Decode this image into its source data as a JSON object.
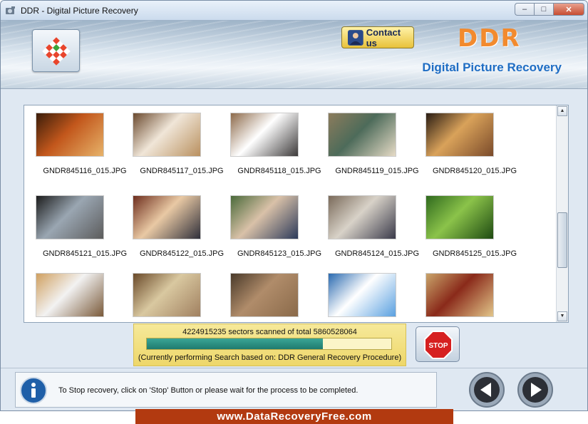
{
  "window": {
    "title": "DDR - Digital Picture Recovery",
    "controls": {
      "minimize": "–",
      "maximize": "□",
      "close": "✕"
    }
  },
  "header": {
    "contact_label": "Contact us",
    "brand_name": "DDR",
    "brand_subtitle": "Digital Picture Recovery",
    "brand_color": "#f28a2e",
    "subtitle_color": "#1f6dc4"
  },
  "gallery": {
    "items": [
      {
        "name": "GNDR845116_015.JPG",
        "palette": [
          "#3b1d0a",
          "#c2571c",
          "#e7b36a"
        ]
      },
      {
        "name": "GNDR845117_015.JPG",
        "palette": [
          "#6b4a2f",
          "#f0e6d8",
          "#b9905f"
        ]
      },
      {
        "name": "GNDR845118_015.JPG",
        "palette": [
          "#8d6a4a",
          "#ffffff",
          "#3d3a3a"
        ]
      },
      {
        "name": "GNDR845119_015.JPG",
        "palette": [
          "#8c7c5c",
          "#4d6b5a",
          "#e6dbc6"
        ]
      },
      {
        "name": "GNDR845120_015.JPG",
        "palette": [
          "#2a1d14",
          "#d9a25a",
          "#7a4a2a"
        ]
      },
      {
        "name": "GNDR845121_015.JPG",
        "palette": [
          "#1c1c1c",
          "#9aa6b2",
          "#5c5c5c"
        ]
      },
      {
        "name": "GNDR845122_015.JPG",
        "palette": [
          "#6e2e1e",
          "#e9c9a4",
          "#2f2f3a"
        ]
      },
      {
        "name": "GNDR845123_015.JPG",
        "palette": [
          "#4a6a3a",
          "#d9c1a8",
          "#2c3a5a"
        ]
      },
      {
        "name": "GNDR845124_015.JPG",
        "palette": [
          "#7a6a5a",
          "#d8d2c8",
          "#3a3a4a"
        ]
      },
      {
        "name": "GNDR845125_015.JPG",
        "palette": [
          "#2f6a1e",
          "#8bc34a",
          "#1e4a12"
        ]
      },
      {
        "name": "",
        "palette": [
          "#d0a060",
          "#f2f2f2",
          "#7a5a3a"
        ]
      },
      {
        "name": "",
        "palette": [
          "#6a4a2a",
          "#d9c8a0",
          "#a08060"
        ]
      },
      {
        "name": "",
        "palette": [
          "#4a3a2a",
          "#b08c6a",
          "#8a6a4a"
        ]
      },
      {
        "name": "",
        "palette": [
          "#2a6ab0",
          "#ffffff",
          "#5aa0e0"
        ]
      },
      {
        "name": "",
        "palette": [
          "#c9a46a",
          "#8a2a1a",
          "#e2c68a"
        ]
      }
    ]
  },
  "progress": {
    "status_text": "4224915235 sectors scanned of total 5860528064",
    "scanned": 4224915235,
    "total": 5860528064,
    "method_text": "(Currently performing Search based on:  DDR General Recovery Procedure)"
  },
  "stop_button": {
    "label": "STOP"
  },
  "footer": {
    "hint": "To Stop recovery, click on 'Stop' Button or please wait for the process to be completed.",
    "website": "www.DataRecoveryFree.com"
  },
  "icons": {
    "app": "checker-logo-icon",
    "contact": "person-icon",
    "info": "info-icon",
    "back": "back-arrow-icon",
    "next": "next-arrow-icon"
  }
}
